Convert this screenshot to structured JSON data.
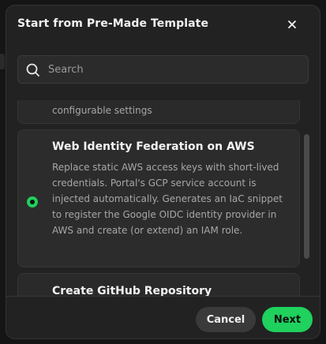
{
  "dialog": {
    "title": "Start from Pre-Made Template",
    "close_label": "×"
  },
  "search": {
    "placeholder": "Search",
    "value": ""
  },
  "templates": [
    {
      "title": "",
      "description": "configurable settings",
      "selected": false
    },
    {
      "title": "Web Identity Federation on AWS",
      "description": "Replace static AWS access keys with short-lived credentials. Portal's GCP service account is injected automatically. Generates an IaC snippet to register the Google OIDC identity provider in AWS and create (or extend) an IAM role.",
      "selected": true
    },
    {
      "title": "Create GitHub Repository",
      "description": "",
      "selected": false
    }
  ],
  "footer": {
    "cancel_label": "Cancel",
    "next_label": "Next"
  },
  "colors": {
    "accent": "#1fd15d",
    "modal_bg": "#222222",
    "card_bg": "#2a2a2a"
  }
}
